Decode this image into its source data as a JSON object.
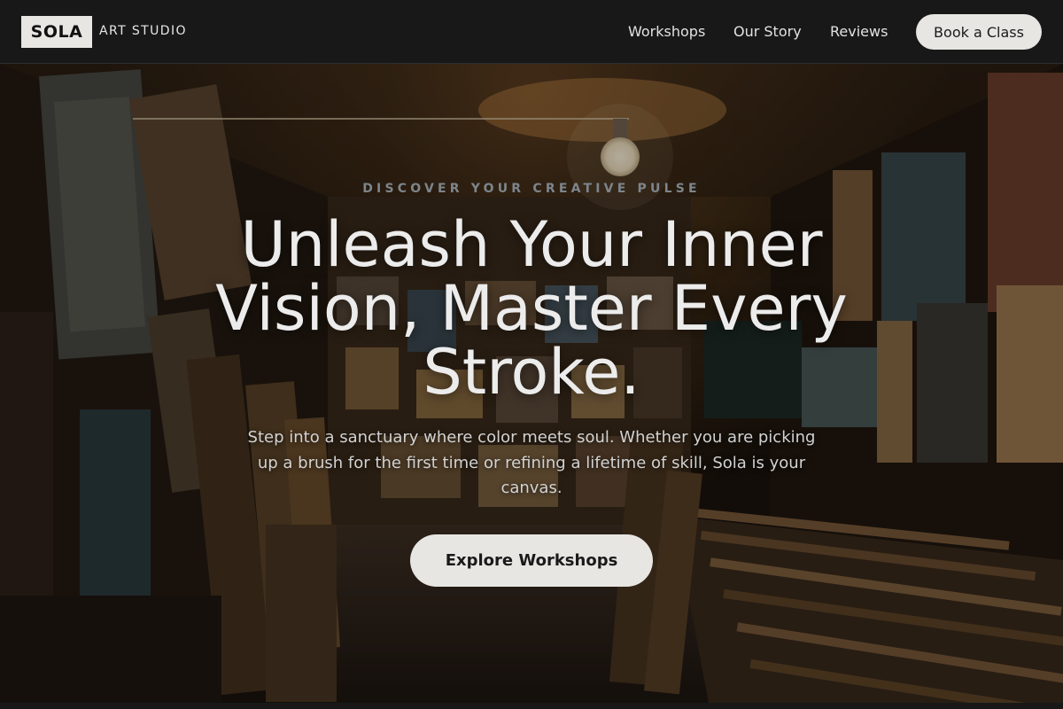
{
  "header": {
    "logo": "SOLA",
    "logo_subtitle": "ART STUDIO",
    "nav": [
      "Workshops",
      "Our Story",
      "Reviews"
    ],
    "cta": "Book a Class"
  },
  "hero": {
    "eyebrow": "DISCOVER YOUR CREATIVE PULSE",
    "headline": "Unleash Your Inner Vision, Master Every Stroke.",
    "subtext": "Step into a sanctuary where color meets soul. Whether you are picking up a brush for the first time or refining a lifetime of skill, Sola is your canvas.",
    "button": "Explore Workshops",
    "background_image": "art-studio-gallery-photo"
  },
  "colors": {
    "header_bg": "#181818",
    "button_bg": "#e8e6e3",
    "text_light": "#ececec",
    "eyebrow": "#7d858c"
  }
}
